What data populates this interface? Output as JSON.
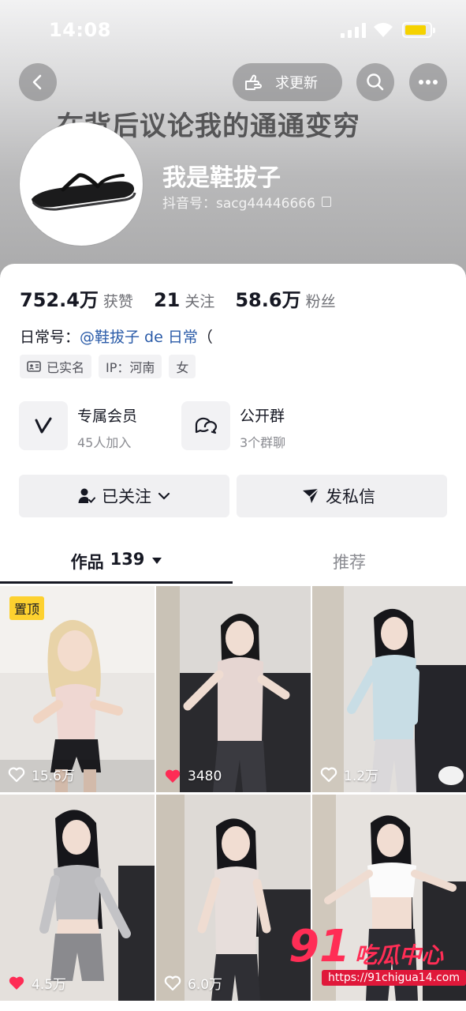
{
  "status": {
    "time": "14:08"
  },
  "header": {
    "request_update": "求更新",
    "banner": "在背后议论我的通通变穷",
    "nickname": "我是鞋拔子",
    "uid": "抖音号：sacg44446666"
  },
  "stats": [
    {
      "value": "752.4万",
      "label": "获赞"
    },
    {
      "value": "21",
      "label": "关注"
    },
    {
      "value": "58.6万",
      "label": "粉丝"
    }
  ],
  "bio": {
    "prefix": "日常号：",
    "mention": "@鞋拔子 de 日常",
    "suffix": "（"
  },
  "tags": {
    "verified": "已实名",
    "ip": "IP：河南",
    "gender": "女"
  },
  "features": {
    "membership": {
      "title": "专属会员",
      "sub": "45人加入"
    },
    "group": {
      "title": "公开群",
      "sub": "3个群聊"
    }
  },
  "actions": {
    "following": "已关注",
    "message": "发私信"
  },
  "tabs": {
    "works_label": "作品",
    "works_count": "139",
    "recommend": "推荐"
  },
  "videos": [
    {
      "likes": "15.6万",
      "pinned": "置顶",
      "liked": false
    },
    {
      "likes": "3480",
      "liked": true
    },
    {
      "likes": "1.2万",
      "liked": false
    },
    {
      "likes": "4.5万",
      "liked": true
    },
    {
      "likes": "6.0万",
      "liked": false
    },
    {
      "likes": "",
      "liked": false
    }
  ],
  "watermark": {
    "brand_num": "91",
    "brand_cn": "吃瓜中心",
    "url": "https://91chigua14.com"
  },
  "colors": {
    "accent_like": "#fe2c55",
    "pin": "#fdd12f",
    "mention": "#2a5ba8"
  }
}
